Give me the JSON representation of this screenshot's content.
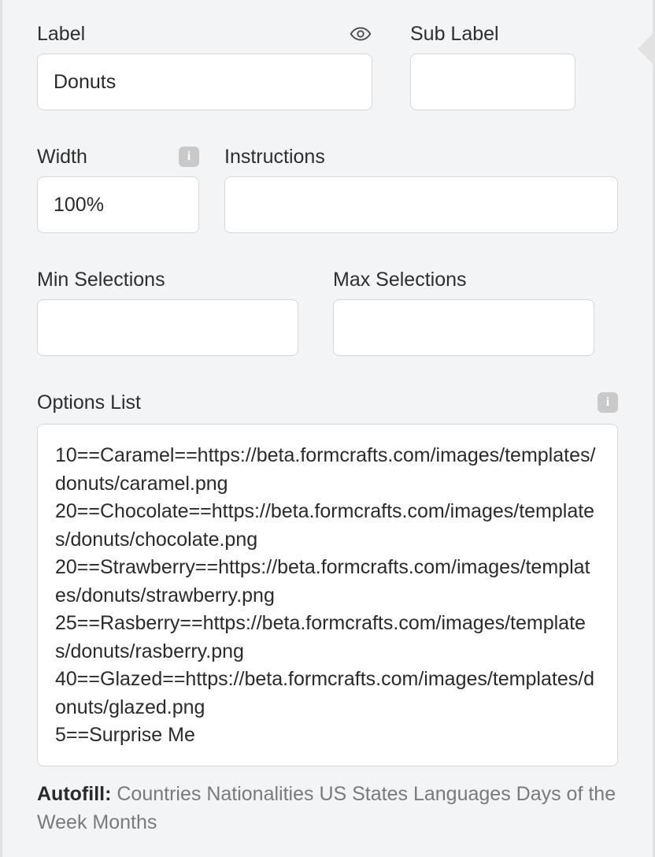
{
  "labels": {
    "label": "Label",
    "sub_label": "Sub Label",
    "width": "Width",
    "instructions": "Instructions",
    "min_selections": "Min Selections",
    "max_selections": "Max Selections",
    "options_list": "Options List",
    "autofill": "Autofill:"
  },
  "values": {
    "label": "Donuts",
    "sub_label": "",
    "width": "100%",
    "instructions": "",
    "min_selections": "",
    "max_selections": "",
    "options_list": "10==Caramel==https://beta.formcrafts.com/images/templates/donuts/caramel.png\n20==Chocolate==https://beta.formcrafts.com/images/templates/donuts/chocolate.png\n20==Strawberry==https://beta.formcrafts.com/images/templates/donuts/strawberry.png\n25==Rasberry==https://beta.formcrafts.com/images/templates/donuts/rasberry.png\n40==Glazed==https://beta.formcrafts.com/images/templates/donuts/glazed.png\n5==Surprise Me"
  },
  "autofill_options": [
    "Countries",
    "Nationalities",
    "US States",
    "Languages",
    "Days of the Week",
    "Months"
  ],
  "icons": {
    "info": "i"
  }
}
